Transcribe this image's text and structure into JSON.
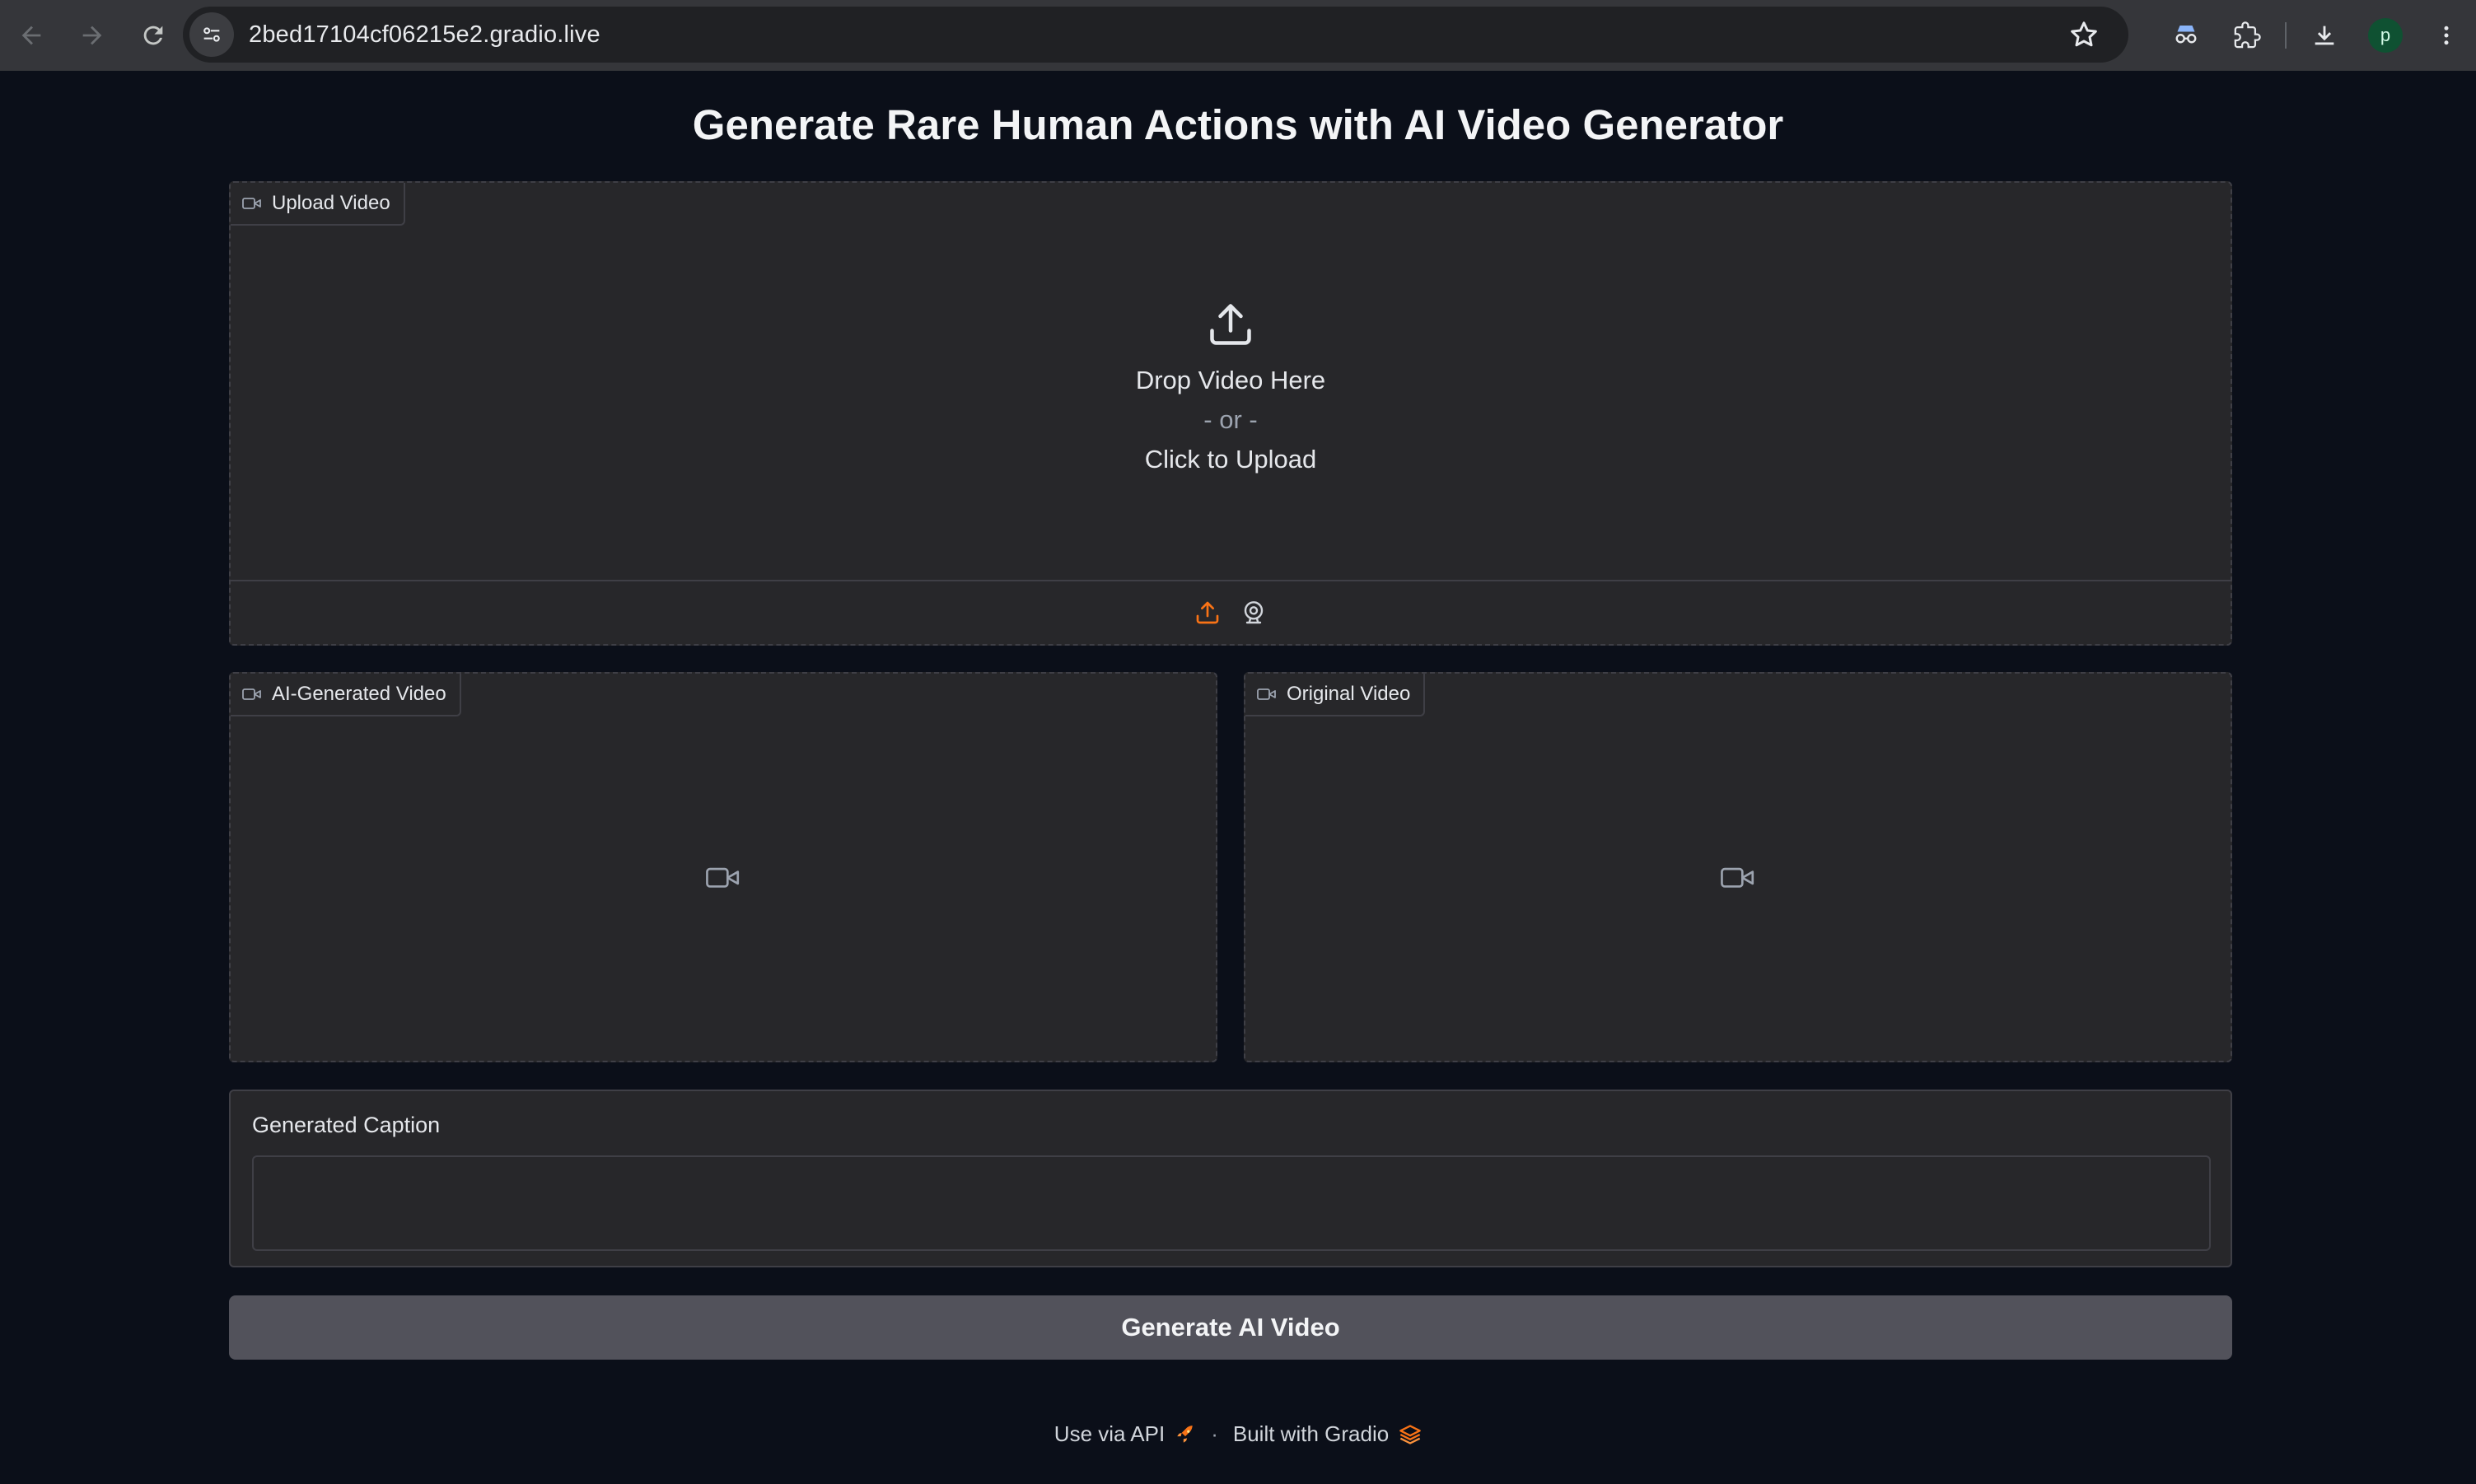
{
  "browser": {
    "url": "2bed17104cf06215e2.gradio.live",
    "profile_initial": "p",
    "icons": [
      "back-icon",
      "forward-icon",
      "reload-icon",
      "site-settings-icon",
      "star-icon",
      "incognito-glasses-icon",
      "extensions-icon",
      "download-icon",
      "kebab-menu-icon"
    ]
  },
  "page": {
    "title": "Generate Rare Human Actions with AI Video Generator"
  },
  "upload": {
    "label": "Upload Video",
    "drop_text": "Drop Video Here",
    "or_text": "- or -",
    "click_text": "Click to Upload",
    "accent_color": "#f97316"
  },
  "ai_video": {
    "label": "AI-Generated Video"
  },
  "original_video": {
    "label": "Original Video"
  },
  "caption": {
    "label": "Generated Caption",
    "value": ""
  },
  "generate_button": {
    "label": "Generate AI Video"
  },
  "footer": {
    "api_text": "Use via API",
    "separator": "·",
    "built_text": "Built with Gradio"
  }
}
